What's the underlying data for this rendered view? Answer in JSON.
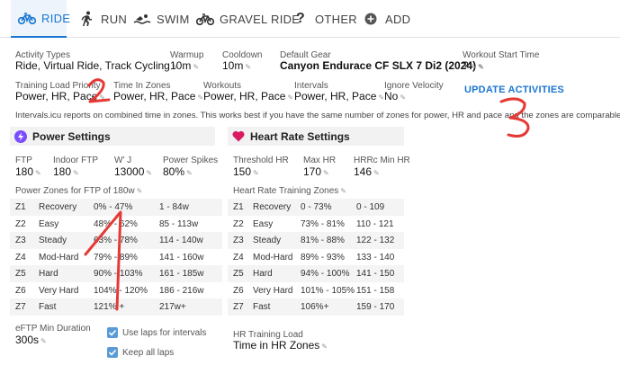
{
  "tabs": [
    {
      "label": "RIDE",
      "icon": "bike-icon",
      "active": true
    },
    {
      "label": "RUN",
      "icon": "runner-icon"
    },
    {
      "label": "SWIM",
      "icon": "swimmer-icon"
    },
    {
      "label": "GRAVEL RIDE",
      "icon": "bike-icon"
    },
    {
      "label": "OTHER",
      "icon": "question-icon"
    },
    {
      "label": "ADD",
      "icon": "plus-icon"
    }
  ],
  "fields": {
    "activity_types": {
      "label": "Activity Types",
      "value": "Ride, Virtual Ride, Track Cycling"
    },
    "warmup": {
      "label": "Warmup",
      "value": "10m"
    },
    "cooldown": {
      "label": "Cooldown",
      "value": "10m"
    },
    "default_gear": {
      "label": "Default Gear",
      "value": "Canyon Endurace CF SLX 7 Di2 (2024)"
    },
    "workout_start_time": {
      "label": "Workout Start Time",
      "value": "?"
    },
    "training_load_priority": {
      "label": "Training Load Priority",
      "value": "Power, HR, Pace"
    },
    "time_in_zones": {
      "label": "Time In Zones",
      "value": "Power, HR, Pace"
    },
    "workouts": {
      "label": "Workouts",
      "value": "Power, HR, Pace"
    },
    "intervals": {
      "label": "Intervals",
      "value": "Power, HR, Pace"
    },
    "ignore_velocity": {
      "label": "Ignore Velocity",
      "value": "No"
    }
  },
  "update_button": "UPDATE ACTIVITIES",
  "note": "Intervals.icu reports on combined time in zones. This works best if you have the same number of zones for power, HR and pace and the zones are comparable.",
  "power": {
    "title": "Power Settings",
    "ftp": {
      "label": "FTP",
      "value": "180"
    },
    "indoor_ftp": {
      "label": "Indoor FTP",
      "value": "180"
    },
    "wprime": {
      "label": "W' J",
      "value": "13000"
    },
    "power_spikes": {
      "label": "Power Spikes",
      "value": "80%"
    },
    "zones_title": "Power Zones for FTP of 180w",
    "zones": [
      {
        "id": "Z1",
        "name": "Recovery",
        "pct": "0% - 47%",
        "range": "1 - 84w"
      },
      {
        "id": "Z2",
        "name": "Easy",
        "pct": "48% - 62%",
        "range": "85 - 113w"
      },
      {
        "id": "Z3",
        "name": "Steady",
        "pct": "63% - 78%",
        "range": "114 - 140w"
      },
      {
        "id": "Z4",
        "name": "Mod-Hard",
        "pct": "79% - 89%",
        "range": "141 - 160w"
      },
      {
        "id": "Z5",
        "name": "Hard",
        "pct": "90% - 103%",
        "range": "161 - 185w"
      },
      {
        "id": "Z6",
        "name": "Very Hard",
        "pct": "104% - 120%",
        "range": "186 - 216w"
      },
      {
        "id": "Z7",
        "name": "Fast",
        "pct": "121% +",
        "range": "217w+"
      }
    ],
    "eftp": {
      "label": "eFTP Min Duration",
      "value": "300s"
    },
    "use_laps": "Use laps for intervals",
    "keep_laps": "Keep all laps"
  },
  "hr": {
    "title": "Heart Rate Settings",
    "threshold": {
      "label": "Threshold HR",
      "value": "150"
    },
    "max": {
      "label": "Max HR",
      "value": "170"
    },
    "hrrc": {
      "label": "HRRc Min HR",
      "value": "146"
    },
    "zones_title": "Heart Rate Training Zones",
    "zones": [
      {
        "id": "Z1",
        "name": "Recovery",
        "pct": "0 - 73%",
        "range": "0 - 109"
      },
      {
        "id": "Z2",
        "name": "Easy",
        "pct": "73% - 81%",
        "range": "110 - 121"
      },
      {
        "id": "Z3",
        "name": "Steady",
        "pct": "81% - 88%",
        "range": "122 - 132"
      },
      {
        "id": "Z4",
        "name": "Mod-Hard",
        "pct": "89% - 93%",
        "range": "133 - 140"
      },
      {
        "id": "Z5",
        "name": "Hard",
        "pct": "94% - 100%",
        "range": "141 - 150"
      },
      {
        "id": "Z6",
        "name": "Very Hard",
        "pct": "101% - 105%",
        "range": "151 - 158"
      },
      {
        "id": "Z7",
        "name": "Fast",
        "pct": "106%+",
        "range": "159 - 170"
      }
    ],
    "load": {
      "label": "HR Training Load",
      "value": "Time in HR Zones"
    }
  },
  "annotations": [
    "1",
    "2",
    "3"
  ],
  "colors": {
    "accent": "#1976d2",
    "annotation": "#e53935",
    "power_icon": "#7c4dff",
    "heart_icon": "#d81b60"
  }
}
